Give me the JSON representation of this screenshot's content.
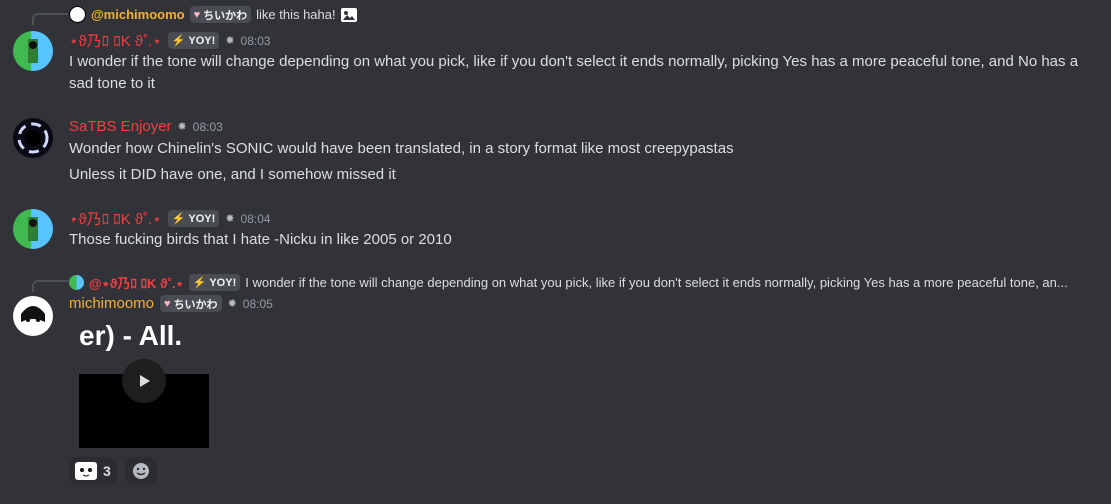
{
  "msg1": {
    "reply_name": "@michimoomo",
    "reply_badge": "ちいかわ",
    "reply_text": "like this haha!",
    "username": "⋆ϑ乃ﾛ ﾛK ϑ˚.⋆",
    "badge": "YOY!",
    "time": "08:03",
    "text": "I wonder if the tone will change depending on what you pick, like if you don't select it ends normally, picking Yes has a more peaceful tone, and No has a sad tone to it"
  },
  "msg2": {
    "username": "SaTBS Enjoyer",
    "time": "08:03",
    "text1": "Wonder how Chinelin's SONIC would have been translated, in a story format like most creepypastas",
    "text2": "Unless it DID have one, and I somehow missed it"
  },
  "msg3": {
    "username": "⋆ϑ乃ﾛ ﾛK ϑ˚.⋆",
    "badge": "YOY!",
    "time": "08:04",
    "text": "Those fucking birds that I hate -Nicku in like 2005 or 2010"
  },
  "msg4": {
    "reply_name": "@⋆ϑ乃ﾛ ﾛK ϑ˚.⋆",
    "reply_badge": "YOY!",
    "reply_text": "I wonder if the tone will change depending on what you pick, like if you don't select it ends normally, picking Yes has a more peaceful tone, an...",
    "username": "michimoomo",
    "badge": "ちいかわ",
    "time": "08:05",
    "video_title": "er) - All.",
    "reaction_count": "3"
  },
  "colors": {
    "background": "#313338",
    "username_red": "#f23f43",
    "username_gold": "#f0b232",
    "text": "#dbdee1",
    "muted": "#949ba4"
  },
  "icons": [
    "image-icon",
    "heart-icon",
    "lightning-icon",
    "server-tag-icon",
    "play-icon",
    "emoji-reaction-icon",
    "add-reaction-icon"
  ]
}
